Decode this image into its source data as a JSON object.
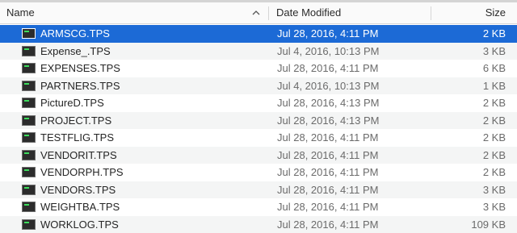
{
  "columns": {
    "name": "Name",
    "date": "Date Modified",
    "size": "Size"
  },
  "sort_icon": "chevron-up-icon",
  "colors": {
    "selection": "#1c6ad6",
    "alt_row": "#f4f5f5",
    "header_bg": "#fafafa"
  },
  "file_icon": "terminal-document-icon",
  "files": [
    {
      "name": "ARMSCG.TPS",
      "date": "Jul 28, 2016, 4:11 PM",
      "size": "2 KB",
      "selected": true
    },
    {
      "name": "Expense_.TPS",
      "date": "Jul 4, 2016, 10:13 PM",
      "size": "3 KB",
      "selected": false
    },
    {
      "name": "EXPENSES.TPS",
      "date": "Jul 28, 2016, 4:11 PM",
      "size": "6 KB",
      "selected": false
    },
    {
      "name": "PARTNERS.TPS",
      "date": "Jul 4, 2016, 10:13 PM",
      "size": "1 KB",
      "selected": false
    },
    {
      "name": "PictureD.TPS",
      "date": "Jul 28, 2016, 4:13 PM",
      "size": "2 KB",
      "selected": false
    },
    {
      "name": "PROJECT.TPS",
      "date": "Jul 28, 2016, 4:13 PM",
      "size": "2 KB",
      "selected": false
    },
    {
      "name": "TESTFLIG.TPS",
      "date": "Jul 28, 2016, 4:11 PM",
      "size": "2 KB",
      "selected": false
    },
    {
      "name": "VENDORIT.TPS",
      "date": "Jul 28, 2016, 4:11 PM",
      "size": "2 KB",
      "selected": false
    },
    {
      "name": "VENDORPH.TPS",
      "date": "Jul 28, 2016, 4:11 PM",
      "size": "2 KB",
      "selected": false
    },
    {
      "name": "VENDORS.TPS",
      "date": "Jul 28, 2016, 4:11 PM",
      "size": "3 KB",
      "selected": false
    },
    {
      "name": "WEIGHTBA.TPS",
      "date": "Jul 28, 2016, 4:11 PM",
      "size": "3 KB",
      "selected": false
    },
    {
      "name": "WORKLOG.TPS",
      "date": "Jul 28, 2016, 4:11 PM",
      "size": "109 KB",
      "selected": false
    }
  ]
}
